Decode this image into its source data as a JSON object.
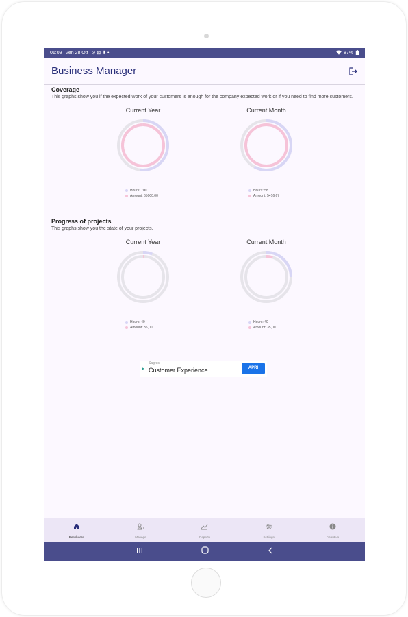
{
  "statusbar": {
    "time": "01:09",
    "date": "Ven 28 Ott",
    "icons": "⊘ ⊠ ⬇ •",
    "battery": "87%"
  },
  "appbar": {
    "title": "Business Manager"
  },
  "coverage": {
    "title": "Coverage",
    "description": "This graphs show you if the expected work of your customers is enough for the company expected work or if you need to find more customers.",
    "charts": [
      {
        "title": "Current Year",
        "legend": [
          {
            "label": "Hours: 700",
            "color": "#d8d6f5"
          },
          {
            "label": "Amount: 65000,00",
            "color": "#f6c3d8"
          }
        ],
        "outer_progress": 0.52,
        "inner_progress": 1.0
      },
      {
        "title": "Current Month",
        "legend": [
          {
            "label": "Hours: 58",
            "color": "#d8d6f5"
          },
          {
            "label": "Amount: 5416,67",
            "color": "#f6c3d8"
          }
        ],
        "outer_progress": 0.58,
        "inner_progress": 1.0
      }
    ]
  },
  "progress": {
    "title": "Progress of projects",
    "description": "This graphs show you the state of your projects.",
    "charts": [
      {
        "title": "Current Year",
        "legend": [
          {
            "label": "Hours: 40",
            "color": "#d8d6f5"
          },
          {
            "label": "Amount: 35,00",
            "color": "#f6c3d8"
          }
        ],
        "outer_progress": 0.06,
        "inner_progress": 0.01
      },
      {
        "title": "Current Month",
        "legend": [
          {
            "label": "Hours: 40",
            "color": "#d8d6f5"
          },
          {
            "label": "Amount: 35,00",
            "color": "#f6c3d8"
          }
        ],
        "outer_progress": 0.25,
        "inner_progress": 0.05
      }
    ]
  },
  "ad": {
    "sponsor": "Sagres",
    "text": "Customer Experience",
    "button": "APRI"
  },
  "bottom_nav": [
    {
      "label": "Dashboard",
      "icon": "home-icon",
      "active": true
    },
    {
      "label": "Manage",
      "icon": "manage-icon",
      "active": false
    },
    {
      "label": "Reports",
      "icon": "chart-icon",
      "active": false
    },
    {
      "label": "Settings",
      "icon": "gear-icon",
      "active": false
    },
    {
      "label": "About us",
      "icon": "info-icon",
      "active": false
    }
  ],
  "colors": {
    "primary": "#4a4d8c",
    "title": "#2a2f7a",
    "ring_track": "#e6e4ea",
    "outer_ring": "#d8d6f5",
    "inner_ring": "#f6c3d8"
  }
}
